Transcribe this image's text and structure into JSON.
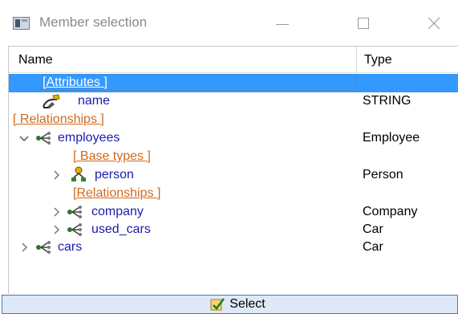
{
  "window": {
    "title": "Member selection",
    "icons": {
      "app": "app-window-icon",
      "minimize": "minimize-icon",
      "maximize": "maximize-icon",
      "close": "close-icon"
    }
  },
  "columns": {
    "name": "Name",
    "type": "Type"
  },
  "rows": [
    {
      "kind": "group",
      "label": "[Attributes ]",
      "type": "",
      "selected": true
    },
    {
      "kind": "attribute",
      "label": "name",
      "type": "STRING",
      "icon": "attribute-icon"
    },
    {
      "kind": "group",
      "label": "[ Relationships ]",
      "type": ""
    },
    {
      "kind": "relationship",
      "label": "employees",
      "type": "Employee",
      "expanded": true,
      "icon": "relationship-icon",
      "chevron": "chevron-down-icon"
    },
    {
      "kind": "group",
      "label": "[ Base types ]",
      "type": ""
    },
    {
      "kind": "basetype",
      "label": "person",
      "type": "Person",
      "expanded": false,
      "icon": "base-type-icon",
      "chevron": "chevron-right-icon"
    },
    {
      "kind": "group",
      "label": "[Relationships ]",
      "type": ""
    },
    {
      "kind": "relationship",
      "label": "company",
      "type": "Company",
      "expanded": false,
      "icon": "relationship-icon",
      "chevron": "chevron-right-icon"
    },
    {
      "kind": "relationship",
      "label": "used_cars",
      "type": "Car",
      "expanded": false,
      "icon": "relationship-icon",
      "chevron": "chevron-right-icon"
    },
    {
      "kind": "relationship",
      "label": "cars",
      "type": "Car",
      "expanded": false,
      "icon": "relationship-icon",
      "chevron": "chevron-right-icon"
    }
  ],
  "select_button": {
    "label": "Select",
    "icon": "select-check-icon"
  },
  "colors": {
    "selection": "#3399ff",
    "member_text": "#1b1bb0",
    "group_text": "#d2691e",
    "button_bg": "#dde9f6",
    "button_border": "#3c7fb1"
  }
}
